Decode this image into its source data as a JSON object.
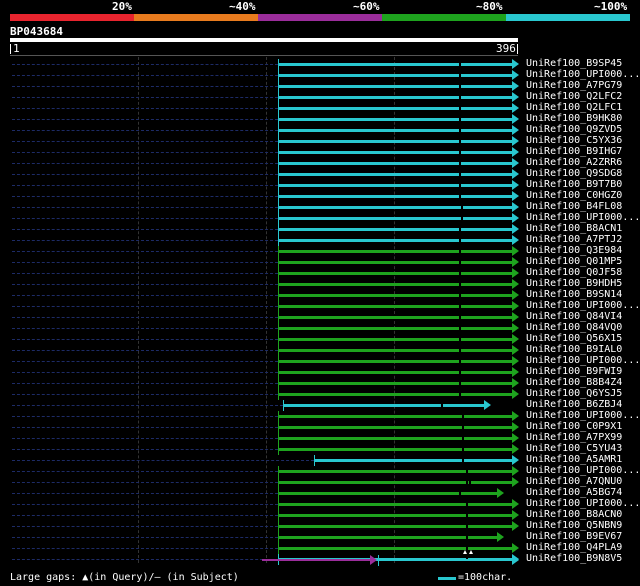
{
  "legend": {
    "labels": [
      "20%",
      "~40%",
      "~60%",
      "~80%",
      "~100%"
    ],
    "colors": [
      "#e8242e",
      "#e87b1e",
      "#9b2d9b",
      "#1ea31e",
      "#29c7cf"
    ]
  },
  "query": {
    "id": "BP043684",
    "start_label": "1",
    "end_label": "396"
  },
  "hits": [
    {
      "label": "UniRef100_B9SP45",
      "color": "#29c7cf"
    },
    {
      "label": "UniRef100_UPI000...",
      "color": "#29c7cf"
    },
    {
      "label": "UniRef100_A7PG79",
      "color": "#29c7cf"
    },
    {
      "label": "UniRef100_Q2LFC2",
      "color": "#29c7cf"
    },
    {
      "label": "UniRef100_Q2LFC1",
      "color": "#29c7cf"
    },
    {
      "label": "UniRef100_B9HK80",
      "color": "#29c7cf"
    },
    {
      "label": "UniRef100_Q9ZVD5",
      "color": "#29c7cf"
    },
    {
      "label": "UniRef100_C5YX36",
      "color": "#29c7cf"
    },
    {
      "label": "UniRef100_B9IHG7",
      "color": "#29c7cf"
    },
    {
      "label": "UniRef100_A2ZRR6",
      "color": "#29c7cf"
    },
    {
      "label": "UniRef100_Q9SDG8",
      "color": "#29c7cf"
    },
    {
      "label": "UniRef100_B9T7B0",
      "color": "#29c7cf"
    },
    {
      "label": "UniRef100_C0HGZ0",
      "color": "#29c7cf"
    },
    {
      "label": "UniRef100_B4FL08",
      "color": "#29c7cf"
    },
    {
      "label": "UniRef100_UPI000...",
      "color": "#29c7cf"
    },
    {
      "label": "UniRef100_B8ACN1",
      "color": "#29c7cf"
    },
    {
      "label": "UniRef100_A7PTJ2",
      "color": "#29c7cf"
    },
    {
      "label": "UniRef100_Q3E984",
      "color": "#1ea31e"
    },
    {
      "label": "UniRef100_Q01MP5",
      "color": "#1ea31e"
    },
    {
      "label": "UniRef100_Q0JF58",
      "color": "#1ea31e"
    },
    {
      "label": "UniRef100_B9HDH5",
      "color": "#1ea31e"
    },
    {
      "label": "UniRef100_B9SN14",
      "color": "#1ea31e"
    },
    {
      "label": "UniRef100_UPI000...",
      "color": "#1ea31e"
    },
    {
      "label": "UniRef100_Q84VI4",
      "color": "#1ea31e"
    },
    {
      "label": "UniRef100_Q84VQ0",
      "color": "#1ea31e"
    },
    {
      "label": "UniRef100_Q56X15",
      "color": "#1ea31e"
    },
    {
      "label": "UniRef100_B9IAL0",
      "color": "#1ea31e"
    },
    {
      "label": "UniRef100_UPI000...",
      "color": "#1ea31e"
    },
    {
      "label": "UniRef100_B9FWI9",
      "color": "#1ea31e"
    },
    {
      "label": "UniRef100_B8B4Z4",
      "color": "#1ea31e"
    },
    {
      "label": "UniRef100_Q6YSJ5",
      "color": "#1ea31e"
    },
    {
      "label": "UniRef100_B6ZBJ4",
      "color": "#29c7cf"
    },
    {
      "label": "UniRef100_UPI000...",
      "color": "#1ea31e"
    },
    {
      "label": "UniRef100_C0P9X1",
      "color": "#1ea31e"
    },
    {
      "label": "UniRef100_A7PX99",
      "color": "#1ea31e"
    },
    {
      "label": "UniRef100_C5YU43",
      "color": "#1ea31e"
    },
    {
      "label": "UniRef100_A5AMR1",
      "color": "#29c7cf"
    },
    {
      "label": "UniRef100_UPI000...",
      "color": "#1ea31e"
    },
    {
      "label": "UniRef100_A7QNU0",
      "color": "#1ea31e"
    },
    {
      "label": "UniRef100_A5BG74",
      "color": "#1ea31e"
    },
    {
      "label": "UniRef100_UPI000...",
      "color": "#1ea31e"
    },
    {
      "label": "UniRef100_B8ACN0",
      "color": "#1ea31e"
    },
    {
      "label": "UniRef100_Q5NBN9",
      "color": "#1ea31e"
    },
    {
      "label": "UniRef100_B9EV67",
      "color": "#1ea31e"
    },
    {
      "label": "UniRef100_Q4PLA9",
      "color": "#1ea31e"
    },
    {
      "label": "UniRef100_B9N8V5",
      "color": "#29c7cf"
    }
  ],
  "footer": {
    "gaps_text": "Large gaps: ▲(in Query)/— (in Subject)",
    "scale_text": "=100char."
  }
}
